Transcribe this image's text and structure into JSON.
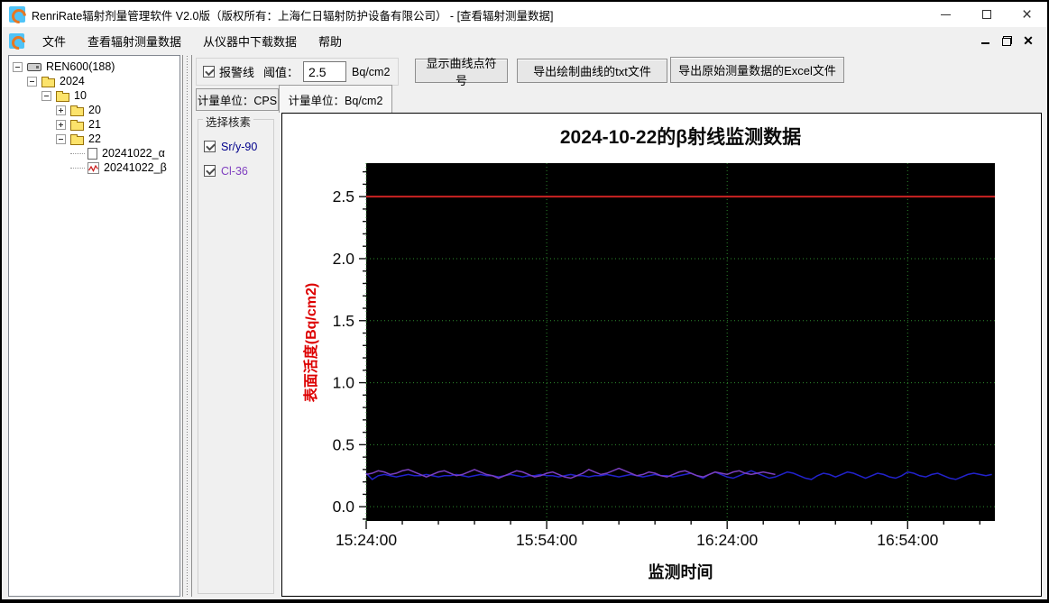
{
  "window": {
    "title": "RenriRate辐射剂量管理软件 V2.0版（版权所有：上海仁日辐射防护设备有限公司） - [查看辐射测量数据]",
    "controls": [
      "minimize",
      "maximize",
      "close"
    ],
    "mdi_controls": [
      "minimize",
      "restore",
      "close"
    ]
  },
  "menu": {
    "items": [
      "文件",
      "查看辐射测量数据",
      "从仪器中下载数据",
      "帮助"
    ]
  },
  "tree": {
    "items": [
      {
        "label": "REN600(188)",
        "level": 0,
        "expander": "minus",
        "icon": "device"
      },
      {
        "label": "2024",
        "level": 1,
        "expander": "minus",
        "icon": "folder"
      },
      {
        "label": "10",
        "level": 2,
        "expander": "minus",
        "icon": "folder"
      },
      {
        "label": "20",
        "level": 3,
        "expander": "plus",
        "icon": "folder"
      },
      {
        "label": "21",
        "level": 3,
        "expander": "plus",
        "icon": "folder"
      },
      {
        "label": "22",
        "level": 3,
        "expander": "minus",
        "icon": "folder"
      },
      {
        "label": "20241022_α",
        "level": 4,
        "expander": null,
        "icon": "file"
      },
      {
        "label": "20241022_β",
        "level": 4,
        "expander": null,
        "icon": "chart-file"
      }
    ]
  },
  "toolbar": {
    "alarm_checkbox_label": "报警线",
    "alarm_checked": true,
    "threshold_label": "阈值：",
    "threshold_value": "2.5",
    "threshold_unit": "Bq/cm2",
    "buttons": [
      "显示曲线点符号",
      "导出绘制曲线的txt文件",
      "导出原始测量数据的Excel文件"
    ]
  },
  "tabs": [
    {
      "label": "计量单位：CPS",
      "active": false
    },
    {
      "label": "计量单位：Bq/cm2",
      "active": true
    }
  ],
  "nuclide_panel": {
    "title": "选择核素",
    "items": [
      {
        "label": "Sr/y-90",
        "checked": true,
        "color": "#00008B"
      },
      {
        "label": "Cl-36",
        "checked": true,
        "color": "#8040C0"
      }
    ]
  },
  "colors": {
    "alarm_line": "#CC2222",
    "grid": "#2E8B2E",
    "plot_bg": "#000000",
    "ylabel": "#DD0000",
    "series_sr": "#2222CC",
    "series_cl": "#7B3FBF"
  },
  "chart_data": {
    "type": "line",
    "title": "2024-10-22的β射线监测数据",
    "xlabel": "监测时间",
    "ylabel": "表面活度(Bq/cm2)",
    "x_start_time": "15:24:00",
    "x_tick_labels": [
      "15:24:00",
      "15:54:00",
      "16:24:00",
      "16:54:00"
    ],
    "x_tick_minutes": [
      0,
      30,
      60,
      90
    ],
    "x_minor_step_min": 6,
    "x_range_min": [
      0,
      104.5
    ],
    "ylim": [
      -0.115,
      2.77
    ],
    "y_ticks": [
      0.0,
      0.5,
      1.0,
      1.5,
      2.0,
      2.5
    ],
    "y_minor_step": 0.1,
    "grid": true,
    "legend_position": "none",
    "alarm_line": {
      "value": 2.5
    },
    "series": [
      {
        "name": "Sr/y-90",
        "step_min": 1,
        "values": [
          0.27,
          0.22,
          0.25,
          0.26,
          0.25,
          0.24,
          0.25,
          0.26,
          0.25,
          0.25,
          0.26,
          0.25,
          0.24,
          0.25,
          0.25,
          0.26,
          0.25,
          0.24,
          0.25,
          0.26,
          0.25,
          0.25,
          0.24,
          0.25,
          0.26,
          0.25,
          0.24,
          0.25,
          0.25,
          0.26,
          0.25,
          0.25,
          0.24,
          0.25,
          0.26,
          0.25,
          0.25,
          0.24,
          0.25,
          0.25,
          0.26,
          0.25,
          0.24,
          0.25,
          0.26,
          0.25,
          0.24,
          0.25,
          0.26,
          0.25,
          0.25,
          0.24,
          0.25,
          0.26,
          0.27,
          0.25,
          0.23,
          0.26,
          0.28,
          0.26,
          0.24,
          0.23,
          0.25,
          0.27,
          0.29,
          0.27,
          0.25,
          0.23,
          0.24,
          0.26,
          0.28,
          0.27,
          0.25,
          0.23,
          0.22,
          0.25,
          0.27,
          0.26,
          0.24,
          0.26,
          0.28,
          0.27,
          0.25,
          0.23,
          0.25,
          0.27,
          0.26,
          0.24,
          0.23,
          0.25,
          0.28,
          0.27,
          0.25,
          0.24,
          0.26,
          0.27,
          0.25,
          0.23,
          0.22,
          0.24,
          0.26,
          0.27,
          0.26,
          0.25,
          0.26
        ]
      },
      {
        "name": "Cl-36",
        "step_min": 1,
        "values": [
          0.26,
          0.27,
          0.29,
          0.28,
          0.26,
          0.27,
          0.29,
          0.3,
          0.28,
          0.26,
          0.24,
          0.26,
          0.28,
          0.29,
          0.27,
          0.25,
          0.26,
          0.28,
          0.3,
          0.28,
          0.26,
          0.25,
          0.23,
          0.25,
          0.27,
          0.29,
          0.28,
          0.26,
          0.24,
          0.25,
          0.27,
          0.28,
          0.26,
          0.24,
          0.23,
          0.25,
          0.27,
          0.3,
          0.28,
          0.26,
          0.27,
          0.29,
          0.31,
          0.29,
          0.27,
          0.25,
          0.26,
          0.28,
          0.27,
          0.25,
          0.24,
          0.26,
          0.28,
          0.29,
          0.27,
          0.25,
          0.24,
          0.26,
          0.28,
          0.27,
          0.26,
          0.28,
          0.29,
          0.27,
          0.26,
          0.27,
          0.28,
          0.27,
          0.26
        ]
      }
    ]
  }
}
